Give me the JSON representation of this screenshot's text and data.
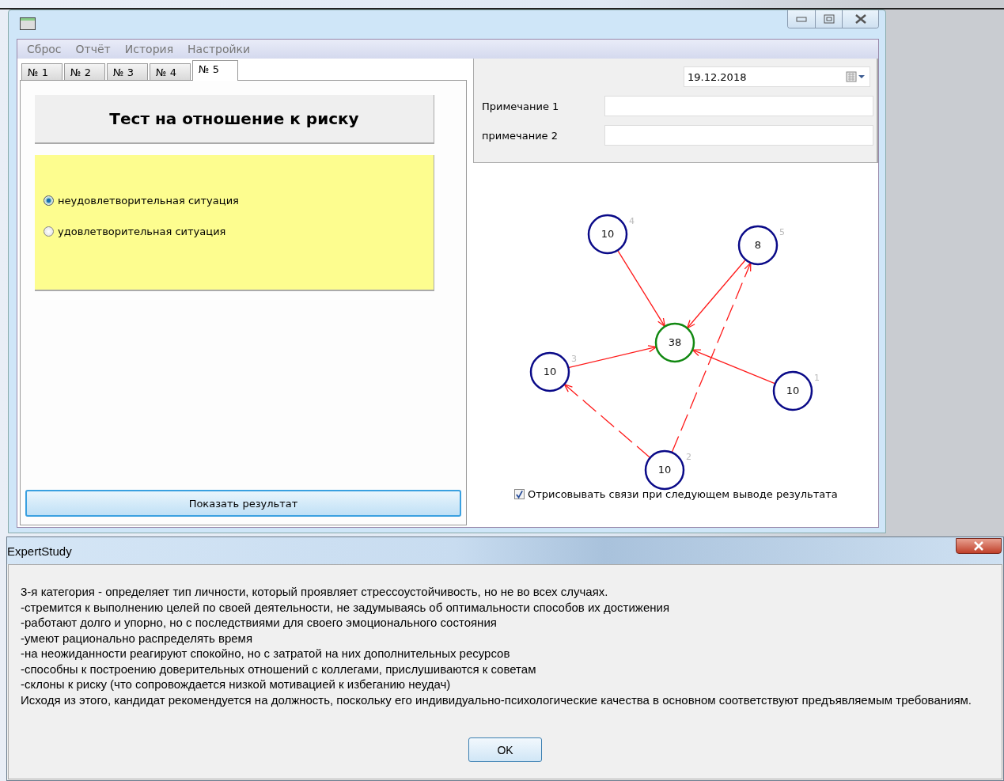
{
  "main_window": {
    "menu": [
      "Сброс",
      "Отчёт",
      "История",
      "Настройки"
    ],
    "tabs": [
      {
        "label": "№ 1",
        "selected": false
      },
      {
        "label": "№ 2",
        "selected": false
      },
      {
        "label": "№ 3",
        "selected": false
      },
      {
        "label": "№ 4",
        "selected": false
      },
      {
        "label": "№ 5",
        "selected": true
      }
    ],
    "test_title": "Тест на отношение к риску",
    "options": [
      {
        "label": "неудовлетворительная ситуация",
        "selected": true
      },
      {
        "label": "удовлетворительная ситуация",
        "selected": false
      }
    ],
    "show_button": "Показать результат",
    "date_field": {
      "value": "19.12.2018"
    },
    "notes": [
      {
        "label": "Примечание 1"
      },
      {
        "label": "примечание 2"
      }
    ],
    "graph": {
      "nodes": [
        {
          "value": "38",
          "color": "#118811"
        },
        {
          "number": "1",
          "value": "10",
          "color": "#0a0a88"
        },
        {
          "number": "2",
          "value": "10",
          "color": "#0a0a88"
        },
        {
          "number": "3",
          "value": "10",
          "color": "#0a0a88"
        },
        {
          "number": "4",
          "value": "10",
          "color": "#0a0a88"
        },
        {
          "number": "5",
          "value": "8",
          "color": "#0a0a88"
        }
      ],
      "edges": [
        {
          "kind": "solid"
        },
        {
          "kind": "solid"
        },
        {
          "kind": "solid"
        },
        {
          "kind": "solid"
        },
        {
          "kind": "dashed"
        },
        {
          "kind": "dashed"
        }
      ]
    },
    "draw_links": {
      "label": "Отрисовывать связи при следующем выводе результата",
      "checked": true
    }
  },
  "dialog": {
    "title": "ExpertStudy",
    "lines": [
      "3-я категория - определяет тип личности, который проявляет стрессоустойчивость, но не во всех случаях.",
      "-стремится к выполнению целей по своей деятельности, не задумываясь об оптимальности способов их достижения",
      "-работают долго и упорно, но с последствиями для своего эмоционального состояния",
      "-умеют рационально распределять время",
      "-на неожиданности реагируют спокойно, но с затратой на них дополнительных ресурсов",
      "-способны к построению доверительных отношений с коллегами, прислушиваются к советам",
      "-склоны к риску (что сопровождается низкой мотивацией к избеганию неудач)",
      "Исходя из этого, кандидат рекомендуется на должность, поскольку его индивидуально-психологические качества в основном соответствуют предъявляемым требованиям."
    ],
    "ok_button": "OK"
  }
}
